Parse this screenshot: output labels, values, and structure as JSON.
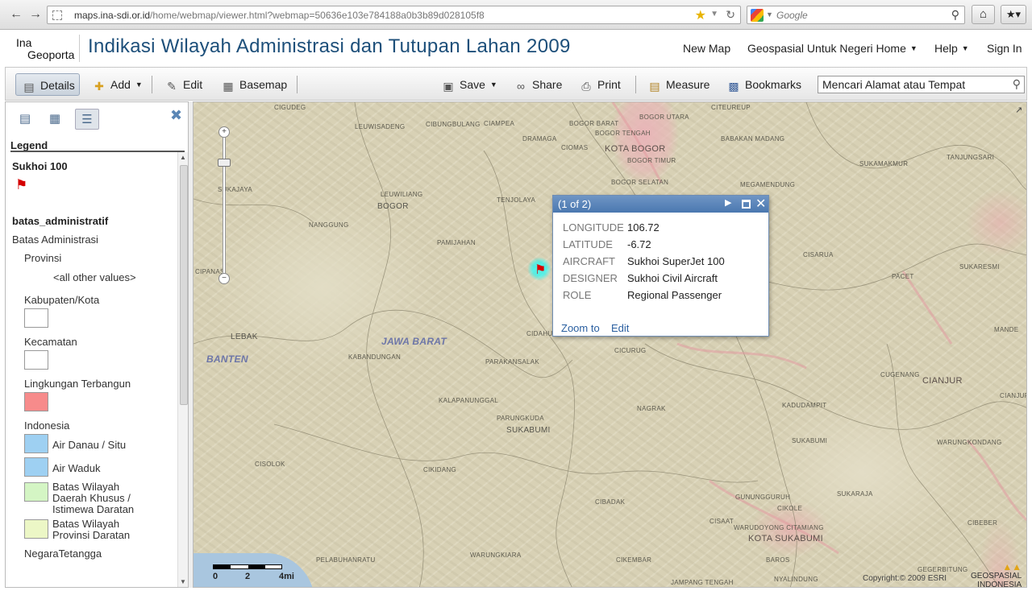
{
  "browser": {
    "url_host": "maps.ina-sdi.or.id",
    "url_path": "/home/webmap/viewer.html?webmap=50636e103e784188a0b3b89d028105f8",
    "search_placeholder": "Google"
  },
  "header": {
    "logo_line1": "Ina",
    "logo_line2": "Geoporta",
    "title": "Indikasi Wilayah Administrasi dan Tutupan Lahan 2009",
    "links": {
      "new_map": "New Map",
      "home": "Geospasial Untuk Negeri Home",
      "help": "Help",
      "sign_in": "Sign In"
    }
  },
  "toolbar": {
    "details": "Details",
    "add": "Add",
    "edit": "Edit",
    "basemap": "Basemap",
    "save": "Save",
    "share": "Share",
    "print": "Print",
    "measure": "Measure",
    "bookmarks": "Bookmarks",
    "find_value": "Mencari Alamat atau Tempat"
  },
  "legend": {
    "heading": "Legend",
    "layer1": "Sukhoi 100",
    "layer2": "batas_administratif",
    "group": "Batas Administrasi",
    "items": {
      "provinsi": "Provinsi",
      "all_other": "<all other values>",
      "kabupaten": "Kabupaten/Kota",
      "kecamatan": "Kecamatan",
      "lingkungan": "Lingkungan Terbangun",
      "indonesia": "Indonesia",
      "danau": "Air Danau / Situ",
      "waduk": "Air Waduk",
      "daerah_khusus_1": "Batas Wilayah",
      "daerah_khusus_2": "Daerah Khusus /",
      "daerah_khusus_3": "Istimewa Daratan",
      "provinsi_daratan_1": "Batas Wilayah",
      "provinsi_daratan_2": "Provinsi Daratan",
      "negara": "NegaraTetangga"
    },
    "colors": {
      "lingkungan": "#f78b8b",
      "danau": "#9ed0f2",
      "waduk": "#9ed0f2",
      "daerah_khusus": "#d4f5c4",
      "provinsi_daratan": "#ecf7c6"
    }
  },
  "popup": {
    "count": "(1 of 2)",
    "fields": [
      {
        "key": "LONGITUDE",
        "value": "106.72"
      },
      {
        "key": "LATITUDE",
        "value": "-6.72"
      },
      {
        "key": "AIRCRAFT",
        "value": "Sukhoi SuperJet 100"
      },
      {
        "key": "DESIGNER",
        "value": "Sukhoi Civil Aircraft"
      },
      {
        "key": "ROLE",
        "value": "Regional Passenger"
      }
    ],
    "zoom_to": "Zoom to",
    "edit": "Edit"
  },
  "map": {
    "labels": {
      "cigudeg": "CIGUDEG",
      "leuwisadeng": "LEUWISADENG",
      "cibungbulang": "CIBUNGBULANG",
      "ciampea": "CIAMPEA",
      "bogor_barat": "BOGOR BARAT",
      "bogor_utara": "BOGOR UTARA",
      "bogor_tengah": "BOGOR TENGAH",
      "citeureup": "CITEUREUP",
      "dramaga": "DRAMAGA",
      "ciomas": "CIOMAS",
      "kota_bogor": "KOTA BOGOR",
      "babakan_madang": "BABAKAN MADANG",
      "bogor_timur": "BOGOR TIMUR",
      "tanjungsari": "TANJUNGSARI",
      "sukamakmur": "SUKAMAKMUR",
      "sukajaya": "SUKAJAYA",
      "leuwiliang": "LEUWILIANG",
      "bogor": "BOGOR",
      "tenjolaya": "TENJOLAYA",
      "bogor_selatan": "BOGOR SELATAN",
      "megamendung": "MEGAMENDUNG",
      "nanggung": "NANGGUNG",
      "pamijahan": "PAMIJAHAN",
      "cisarua": "CISARUA",
      "sukaresmi": "SUKARESMI",
      "cipanas": "CIPANAS",
      "pacet": "PACET",
      "lebak": "LEBAK",
      "banten": "BANTEN",
      "jawa_barat": "JAWA BARAT",
      "cidahu": "CIDAHU",
      "kabandungan": "KABANDUNGAN",
      "parakansalak": "PARAKANSALAK",
      "cicurug": "CICURUG",
      "mande": "MANDE",
      "cugenang": "CUGENANG",
      "cianjur": "CIANJUR",
      "kalapanunggal": "KALAPANUNGGAL",
      "nagrak": "NAGRAK",
      "kadudampit": "KADUDAMPIT",
      "parungkuda": "PARUNGKUDA",
      "sukabumi": "SUKABUMI",
      "sukabumi2": "SUKABUMI",
      "warungkondang": "WARUNGKONDANG",
      "cisolok": "CISOLOK",
      "cikidang": "CIKIDANG",
      "cibadak": "CIBADAK",
      "sukaraja": "SUKARAJA",
      "gunungguruh": "GUNUNGGURUH",
      "cikole": "CIKOLE",
      "cisaat": "CISAAT",
      "warudoyong": "WARUDOYONG CITAMIANG",
      "kota_sukabumi": "KOTA SUKABUMI",
      "cibeber": "CIBEBER",
      "pelabuhanratu": "PELABUHANRATU",
      "warungkiara": "WARUNGKIARA",
      "cikembar": "CIKEMBAR",
      "baros": "BAROS",
      "jampang_tengah": "JAMPANG TENGAH",
      "nyalindung": "NYALINDUNG",
      "gegerbitung": "GEGERBITUNG",
      "cianjur_east": "CIANJUR"
    },
    "scale": {
      "l0": "0",
      "l2": "2",
      "l4": "4mi"
    },
    "copyright": "Copyright:© 2009 ESRI",
    "brand_line1": "GEOSPASIAL",
    "brand_line2": "INDONESIA"
  }
}
